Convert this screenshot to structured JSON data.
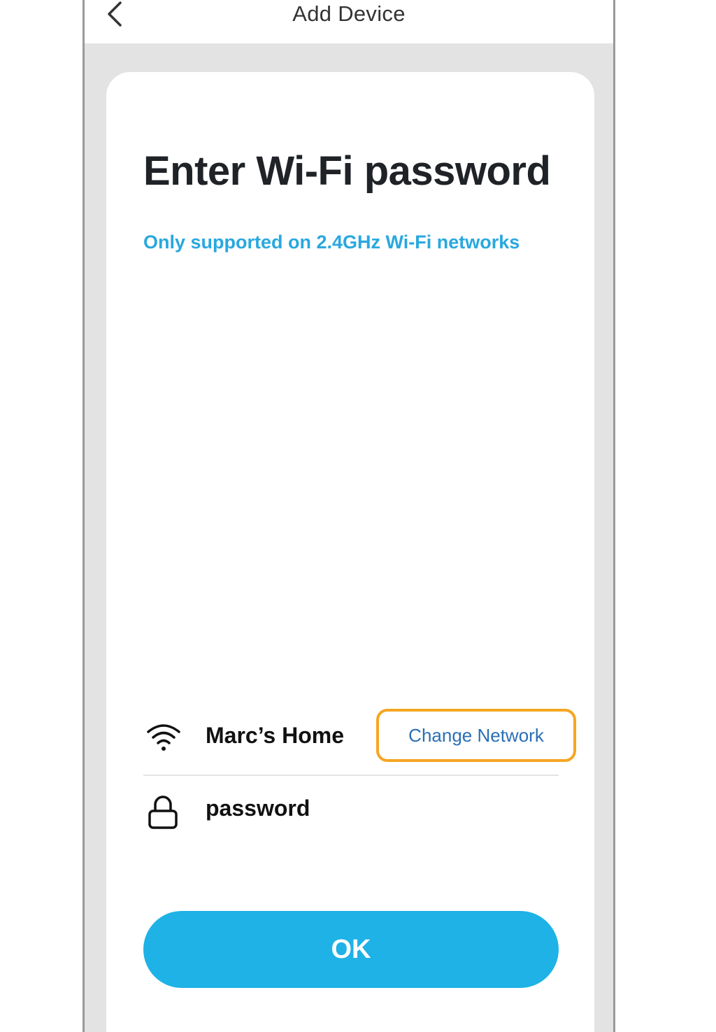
{
  "header": {
    "title": "Add Device",
    "back_icon": "chevron-left-icon"
  },
  "main": {
    "title": "Enter Wi-Fi password",
    "subtitle": "Only supported on 2.4GHz Wi-Fi networks",
    "network": {
      "icon": "wifi-icon",
      "name": "Marc’s Home",
      "change_label": "Change Network"
    },
    "password": {
      "icon": "lock-icon",
      "value": "password"
    },
    "ok_label": "OK"
  },
  "colors": {
    "accent": "#1eb2e6",
    "subtitle": "#29a8df",
    "highlight": "#f5a623",
    "link": "#2a6fb5"
  }
}
